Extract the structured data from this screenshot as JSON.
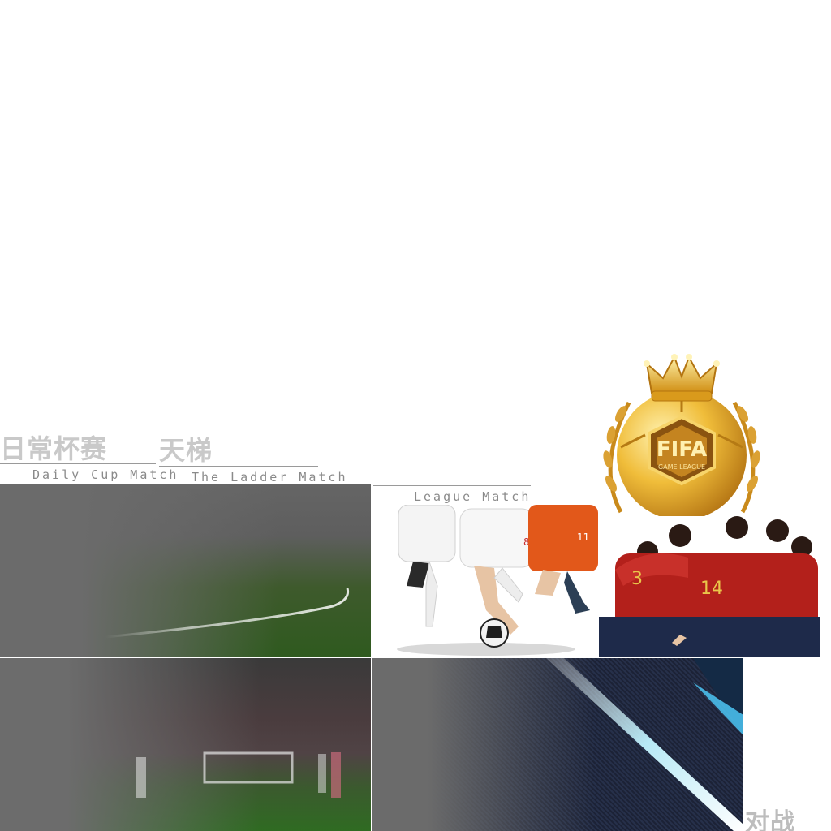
{
  "labels": {
    "daily_cup_cn": "日常杯赛",
    "daily_cup_en": "Daily Cup Match",
    "ladder_cn": "天梯",
    "ladder_en": "The Ladder Match",
    "league_en": "League Match",
    "battle_cn": "对战"
  },
  "badge": {
    "text": "FIFA",
    "subtext": "GAME LEAGUE"
  },
  "jersey_numbers": {
    "orange_player": "11",
    "white_player": "8",
    "red_player_a": "3",
    "red_player_b": "14"
  },
  "colors": {
    "label_gray": "#c9c9c9",
    "panel_gray": "#6b6b6b",
    "gold": "#e0a51c",
    "red_kit": "#b3201b",
    "orange_kit": "#e2581a",
    "cyan_light": "#7fe3ff"
  }
}
